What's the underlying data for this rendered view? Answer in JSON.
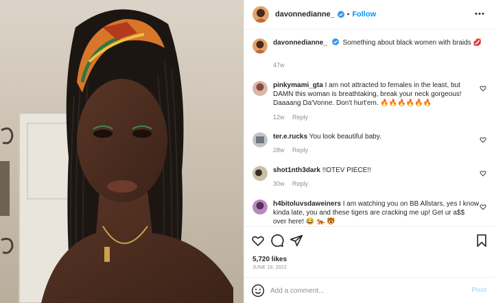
{
  "post": {
    "image_alt": "portrait photo",
    "header": {
      "username": "davonnedianne_",
      "separator": "•",
      "follow_label": "Follow",
      "more_icon": "more-horizontal-icon"
    },
    "caption": {
      "username": "davonnedianne_",
      "text": "Something about black women with braids 💋",
      "time": "47w"
    },
    "comments": [
      {
        "username": "pinkymami_gta",
        "text": "I am not attracted to females in the least, but DAMN this woman is breathtaking, break your neck gorgeous! Daaaang Da'Vonne. Don't hurt'em. 🔥🔥🔥🔥🔥🔥",
        "time": "12w",
        "reply_label": "Reply"
      },
      {
        "username": "ter.e.rucks",
        "text": "You look beautiful baby.",
        "time": "28w",
        "reply_label": "Reply"
      },
      {
        "username": "shot1nth3dark",
        "text": "!!OTEV PIECE!!",
        "time": "30w",
        "reply_label": "Reply"
      },
      {
        "username": "h4bitoluvsdaweiners",
        "text": "I am watching you on BB Allstars, yes I know kinda late, you and these tigers are cracking me up! Get ur a$$ over here! 😂 🐅 🐯",
        "time": "",
        "reply_label": ""
      }
    ],
    "likes": "5,720 likes",
    "date": "JUNE 19, 2022",
    "composer": {
      "placeholder": "Add a comment...",
      "post_label": "Post"
    },
    "colors": {
      "link": "#0095f6",
      "text": "#262626",
      "muted": "#8e8e8e",
      "post_disabled": "#b2dffc"
    }
  }
}
